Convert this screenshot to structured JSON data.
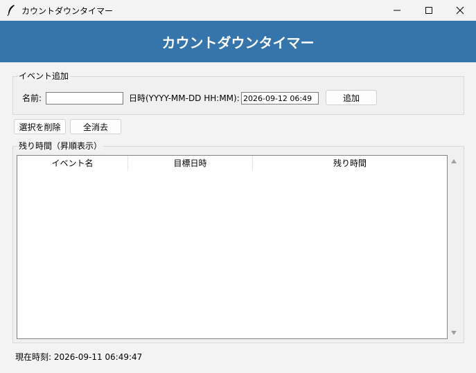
{
  "window": {
    "title": "カウントダウンタイマー"
  },
  "header": {
    "title": "カウントダウンタイマー"
  },
  "add_event": {
    "group_label": "イベント追加",
    "name_label": "名前:",
    "name_value": "",
    "datetime_label": "日時(YYYY-MM-DD HH:MM):",
    "datetime_value": "2026-09-12 06:49",
    "add_button": "追加"
  },
  "actions": {
    "delete_selected": "選択を削除",
    "clear_all": "全消去"
  },
  "remaining": {
    "group_label": "残り時間（昇順表示）",
    "columns": [
      "イベント名",
      "目標日時",
      "残り時間"
    ],
    "rows": []
  },
  "status": {
    "current_time": "現在時刻: 2026-09-11 06:49:47"
  },
  "icons": {
    "app": "feather-icon",
    "minimize": "minimize-icon",
    "maximize": "maximize-icon",
    "close": "close-icon"
  },
  "colors": {
    "header_bg": "#3575ac",
    "header_text": "#ffffff"
  }
}
